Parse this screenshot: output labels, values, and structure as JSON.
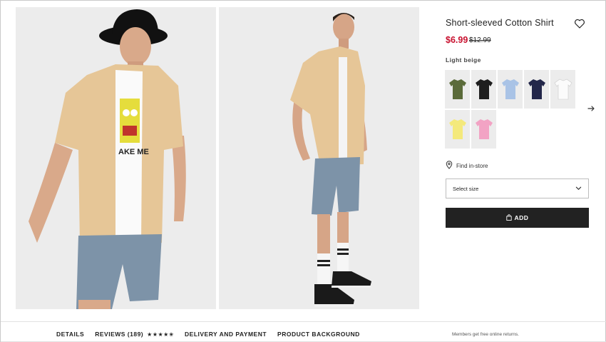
{
  "product": {
    "title": "Short-sleeved Cotton Shirt",
    "price_current": "$6.99",
    "price_original": "$12.99",
    "color_name": "Light beige",
    "swatches": [
      {
        "name": "olive",
        "color": "#5b6b3a"
      },
      {
        "name": "black",
        "color": "#1e1e1e"
      },
      {
        "name": "light-blue",
        "color": "#a9c3e6"
      },
      {
        "name": "navy",
        "color": "#23274a"
      },
      {
        "name": "white",
        "color": "#fbfbfb"
      },
      {
        "name": "yellow",
        "color": "#f4e97c"
      },
      {
        "name": "pink",
        "color": "#f2a3c4"
      }
    ],
    "find_in_store": "Find in-store",
    "size_placeholder": "Select size",
    "add_label": "ADD"
  },
  "colors": {
    "sale_red": "#c8102e",
    "button_dark": "#222222",
    "shirt_beige": "#e6c697"
  },
  "tabs": {
    "details": "DETAILS",
    "reviews": "REVIEWS (189)",
    "stars": "★★★★✬",
    "rating": 4.5,
    "delivery": "DELIVERY AND PAYMENT",
    "background": "PRODUCT BACKGROUND"
  },
  "footer": {
    "members_note": "Members get free online returns."
  },
  "icons": {
    "favorite": "heart-outline-icon",
    "next": "arrow-right-icon",
    "location": "location-pin-icon",
    "dropdown": "chevron-down-icon",
    "bag": "shopping-bag-icon"
  }
}
